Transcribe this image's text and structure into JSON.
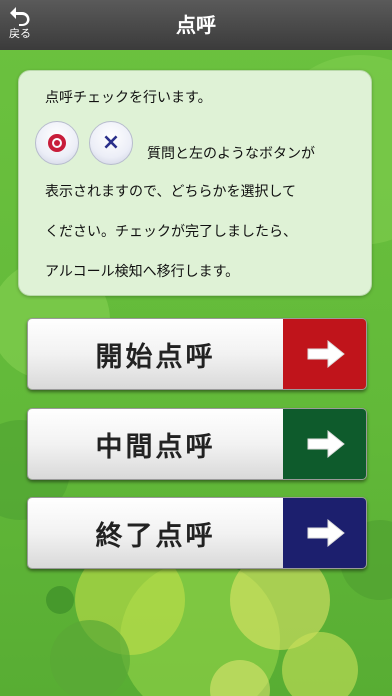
{
  "header": {
    "back_label": "戻る",
    "title": "点呼"
  },
  "info": {
    "line1": "点呼チェックを行います。",
    "line2": "質問と左のようなボタンが",
    "line3": "表示されますので、どちらかを選択して",
    "line4": "ください。チェックが完了しましたら、",
    "line5": "アルコール検知へ移行します。",
    "yes_icon": "maru-circle-icon",
    "no_icon": "batsu-cross-icon",
    "no_symbol": "×"
  },
  "buttons": [
    {
      "label": "開始点呼",
      "color": "#c0141b"
    },
    {
      "label": "中間点呼",
      "color": "#0e5b2c"
    },
    {
      "label": "終了点呼",
      "color": "#1c1f6e"
    }
  ],
  "colors": {
    "header": "#444444",
    "background": "#5fb53a",
    "info_box": "#dff2d6"
  }
}
